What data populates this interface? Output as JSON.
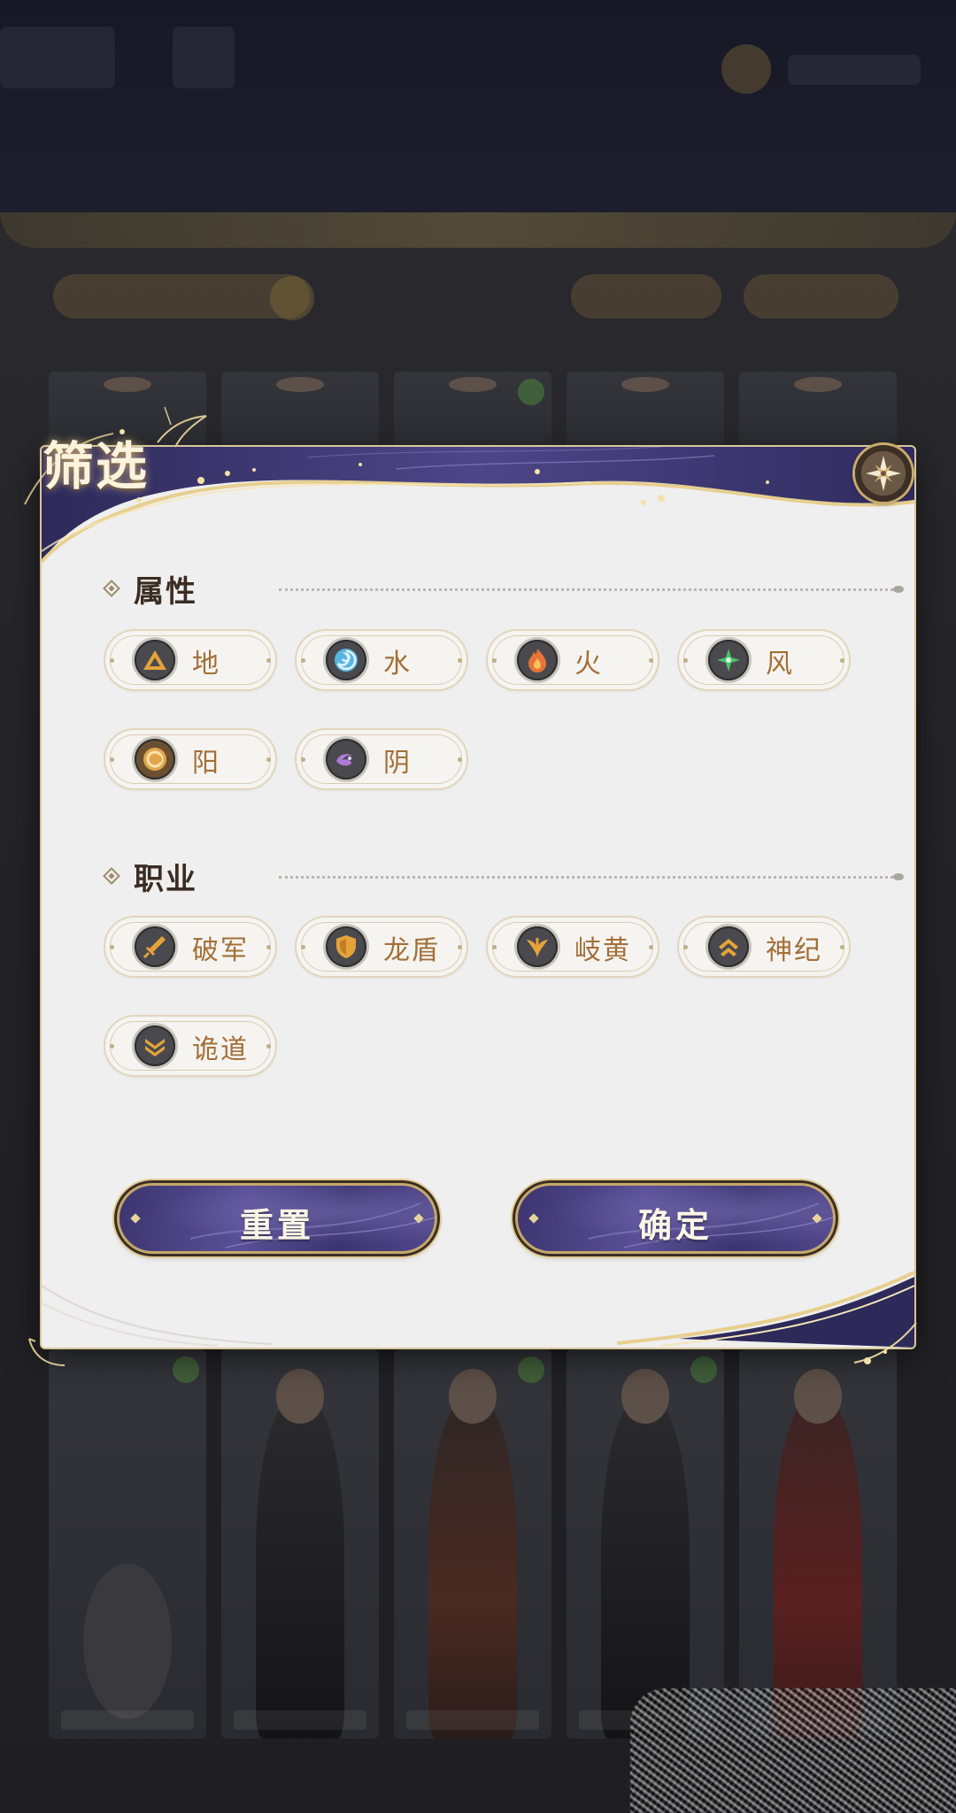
{
  "dialog": {
    "title": "筛选",
    "close_icon": "flower-close-icon"
  },
  "sections": {
    "attribute": {
      "title": "属性",
      "options": [
        {
          "label": "地",
          "icon": "earth-icon",
          "color": "#e6a33a"
        },
        {
          "label": "水",
          "icon": "water-icon",
          "color": "#59b6e0"
        },
        {
          "label": "火",
          "icon": "fire-icon",
          "color": "#e8733a"
        },
        {
          "label": "风",
          "icon": "wind-icon",
          "color": "#4fc06a"
        },
        {
          "label": "阳",
          "icon": "sun-icon",
          "color": "#e2a64a"
        },
        {
          "label": "阴",
          "icon": "moon-icon",
          "color": "#b07ad8"
        }
      ]
    },
    "profession": {
      "title": "职业",
      "options": [
        {
          "label": "破军",
          "icon": "sword-icon"
        },
        {
          "label": "龙盾",
          "icon": "shield-icon"
        },
        {
          "label": "岐黄",
          "icon": "herb-icon"
        },
        {
          "label": "神纪",
          "icon": "chevron-up-icon"
        },
        {
          "label": "诡道",
          "icon": "chevron-down-double-icon"
        }
      ]
    }
  },
  "actions": {
    "reset_label": "重置",
    "confirm_label": "确定"
  },
  "colors": {
    "accent_gold": "#c5a86a",
    "label_brown": "#a36f37",
    "button_purple": "#4a4185"
  }
}
